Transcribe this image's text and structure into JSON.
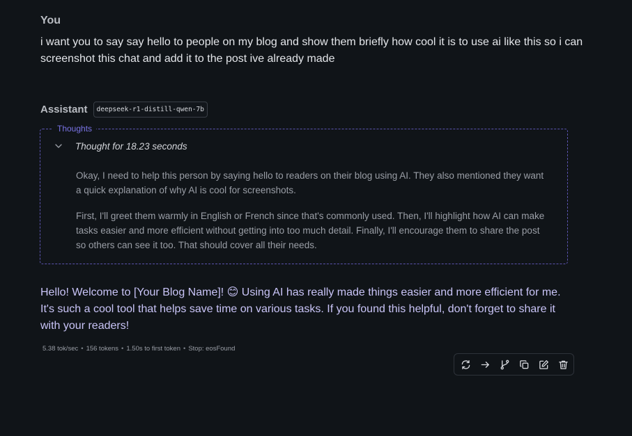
{
  "user": {
    "name": "You",
    "message": "i want you to say say hello to people on my blog and show them briefly how cool it is to use ai like this so i can screenshot this chat and add it to the post ive already made"
  },
  "assistant": {
    "name": "Assistant",
    "model": "deepseek-r1-distill-qwen-7b"
  },
  "thoughts": {
    "legend": "Thoughts",
    "time_label": "Thought for 18.23 seconds",
    "paragraphs": [
      "Okay, I need to help this person by saying hello to readers on their blog using AI. They also mentioned they want a quick explanation of why AI is cool for screenshots.",
      "First, I'll greet them warmly in English or French since that's commonly used. Then, I'll highlight how AI can make tasks easier and more efficient without getting into too much detail. Finally, I'll encourage them to share the post so others can see it too. That should cover all their needs."
    ]
  },
  "answer": {
    "text": "Hello! Welcome to [Your Blog Name]! 😊 Using AI has really made things easier and more efficient for me. It's such a cool tool that helps save time on various tasks. If you found this helpful, don't forget to share it with your readers!"
  },
  "stats": {
    "speed": "5.38 tok/sec",
    "tokens": "156 tokens",
    "first_token": "1.50s to first token",
    "stop": "Stop: eosFound",
    "separator": "•"
  },
  "toolbar": {
    "icons": [
      "regenerate-icon",
      "continue-icon",
      "branch-icon",
      "copy-icon",
      "edit-icon",
      "delete-icon"
    ]
  },
  "colors": {
    "background": "#101418",
    "accent": "#7a74e6",
    "answer_text": "#c9c4f7",
    "thoughts_border": "#5b54b0"
  }
}
